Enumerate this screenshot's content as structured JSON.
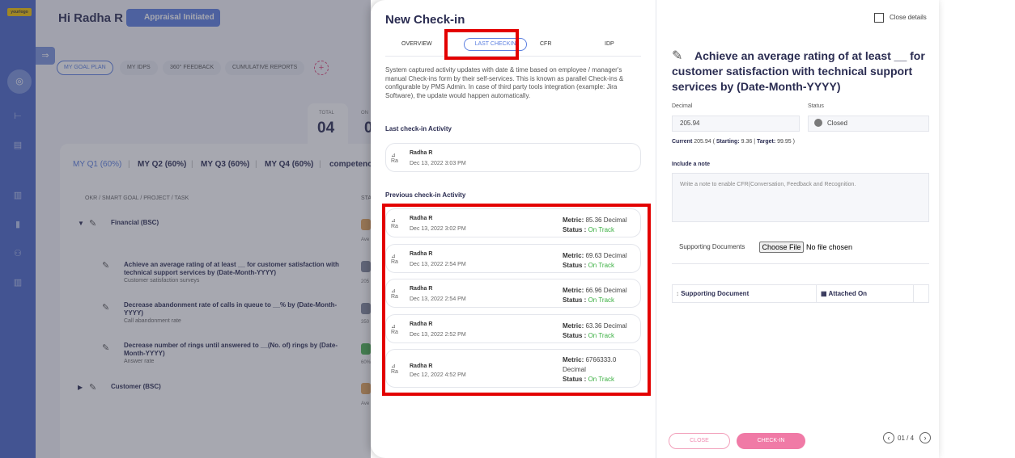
{
  "brand": {
    "logo_text": "yourlogo"
  },
  "app": {
    "greeting": "Hi Radha R",
    "appraisal_badge": "Appraisal Initiated",
    "nav_pills": [
      "MY GOAL PLAN",
      "MY IDPS",
      "360° FEEDBACK",
      "CUMULATIVE REPORTS"
    ],
    "total_label": "TOTAL",
    "total_value": "04",
    "on_label": "ON",
    "on_value": "0",
    "quarters": [
      "MY Q1 (60%)",
      "MY Q2 (60%)",
      "MY Q3 (60%)",
      "MY Q4 (60%)",
      "competency"
    ],
    "column_header": "OKR / SMART GOAL / PROJECT / TASK",
    "column_header2": "STA",
    "groups": [
      "Financial (BSC)",
      "Customer (BSC)"
    ],
    "group_meta": "Ave",
    "tasks": [
      {
        "title": "Achieve an average rating of at least __ for customer satisfaction with technical support services by (Date-Month-YYYY)",
        "sub": "Customer satisfaction surveys",
        "meta": "205"
      },
      {
        "title": "Decrease abandonment rate of calls in queue to __% by (Date-Month-YYYY)",
        "sub": "Call abandonment rate",
        "meta": "350"
      },
      {
        "title": "Decrease number of rings until answered to __(No. of) rings by (Date-Month-YYYY)",
        "sub": "Answer rate",
        "meta": "60%"
      }
    ]
  },
  "checkin": {
    "title": "New Check-in",
    "tabs": [
      "OVERVIEW",
      "LAST CHECKIN",
      "CFR",
      "IDP"
    ],
    "active_tab": "LAST CHECKIN",
    "description": "System captured activity updates with date & time based on employee / manager's manual Check-ins form by their self-services. This is known as parallel Check-ins & configurable by PMS Admin. In case of third party tools integration (example: Jira Software), the update would happen automatically.",
    "last_section": "Last check-in Activity",
    "avatar_alt": "Ra",
    "last": {
      "name": "Radha R",
      "date": "Dec 13, 2022 3:03 PM"
    },
    "prev_section": "Previous check-in Activity",
    "metric_label": "Metric:",
    "status_label": "Status :",
    "previous": [
      {
        "name": "Radha R",
        "date": "Dec 13, 2022 3:02 PM",
        "metric": "85.36 Decimal",
        "status": "On Track"
      },
      {
        "name": "Radha R",
        "date": "Dec 13, 2022 2:54 PM",
        "metric": "69.63 Decimal",
        "status": "On Track"
      },
      {
        "name": "Radha R",
        "date": "Dec 13, 2022 2:54 PM",
        "metric": "66.96 Decimal",
        "status": "On Track"
      },
      {
        "name": "Radha R",
        "date": "Dec 13, 2022 2:52 PM",
        "metric": "63.36 Decimal",
        "status": "On Track"
      },
      {
        "name": "Radha R",
        "date": "Dec 12, 2022 4:52 PM",
        "metric": "6766333.0 Decimal",
        "status": "On Track"
      }
    ]
  },
  "details": {
    "close_label": "Close details",
    "goal_title": "Achieve an average rating of at least __ for customer satisfaction with technical support services by (Date-Month-YYYY)",
    "decimal_label": "Decimal",
    "decimal_value": "205.94",
    "status_label": "Status",
    "status_value": "Closed",
    "current_label": "Current",
    "current_value": "205.94",
    "starting_label": "Starting:",
    "starting_value": "9.36",
    "target_label": "Target:",
    "target_value": "99.95",
    "note_label": "Include a note",
    "note_placeholder": "Write a note to enable CFR(Conversation, Feedback and Recognition.",
    "supporting_label": "Supporting Documents",
    "file_button": "Choose File",
    "file_status": "No file chosen",
    "table_headers": [
      "Supporting Document",
      "Attached On"
    ],
    "close_button": "CLOSE",
    "checkin_button": "CHECK-IN",
    "page_indicator": "01 / 4"
  },
  "colors": {
    "accent": "#5b7fe0",
    "highlight": "#e30000",
    "on_track": "#3cb043",
    "pink": "#f07aa6"
  }
}
